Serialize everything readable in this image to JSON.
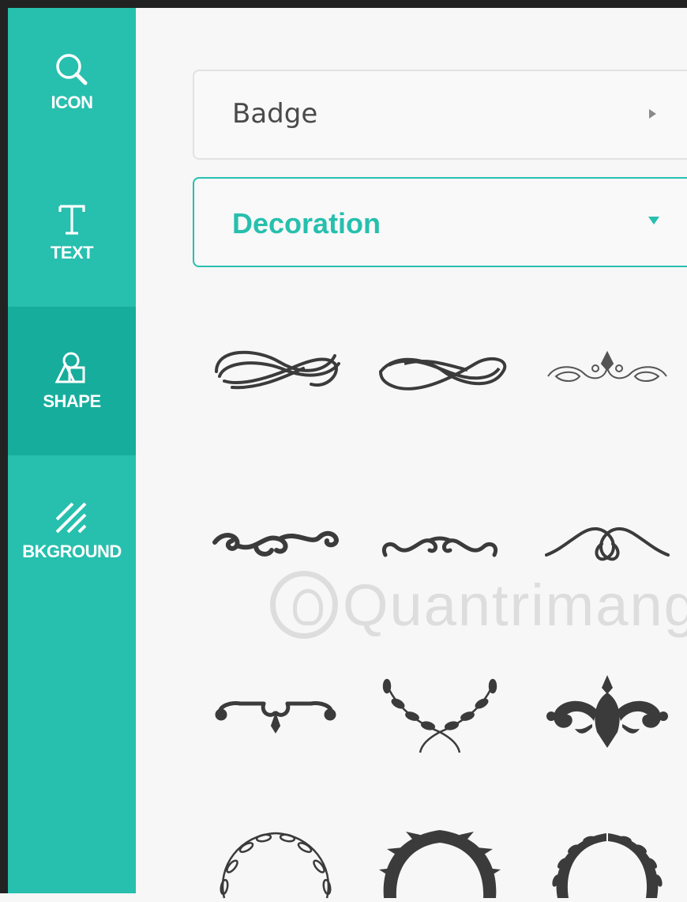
{
  "sidebar": {
    "items": [
      {
        "label": "ICON",
        "icon": "search-icon",
        "active": false
      },
      {
        "label": "TEXT",
        "icon": "text-t-icon",
        "active": false
      },
      {
        "label": "SHAPE",
        "icon": "shapes-icon",
        "active": true
      },
      {
        "label": "BKGROUND",
        "icon": "stripes-icon",
        "active": false
      }
    ]
  },
  "categories": [
    {
      "label": "Badge",
      "state": "collapsed",
      "arrow": "caret-right-icon"
    },
    {
      "label": "Decoration",
      "state": "expanded",
      "arrow": "caret-down-icon"
    }
  ],
  "decorations": [
    "swoosh-flourish",
    "twisted-ribbon-flourish",
    "scroll-crown-flourish",
    "curl-vine-divider",
    "wave-curl-divider",
    "heart-swirl-divider",
    "bracket-scroll-divider",
    "laurel-branch-divider",
    "ornate-damask-ornament",
    "leaf-wreath-outline",
    "laurel-wreath-filled",
    "wheat-wreath"
  ],
  "watermark": {
    "text": "Quantrimang"
  },
  "colors": {
    "accent": "#27bfae",
    "accent_active": "#17ad9d",
    "ornament": "#3b3b3b"
  }
}
